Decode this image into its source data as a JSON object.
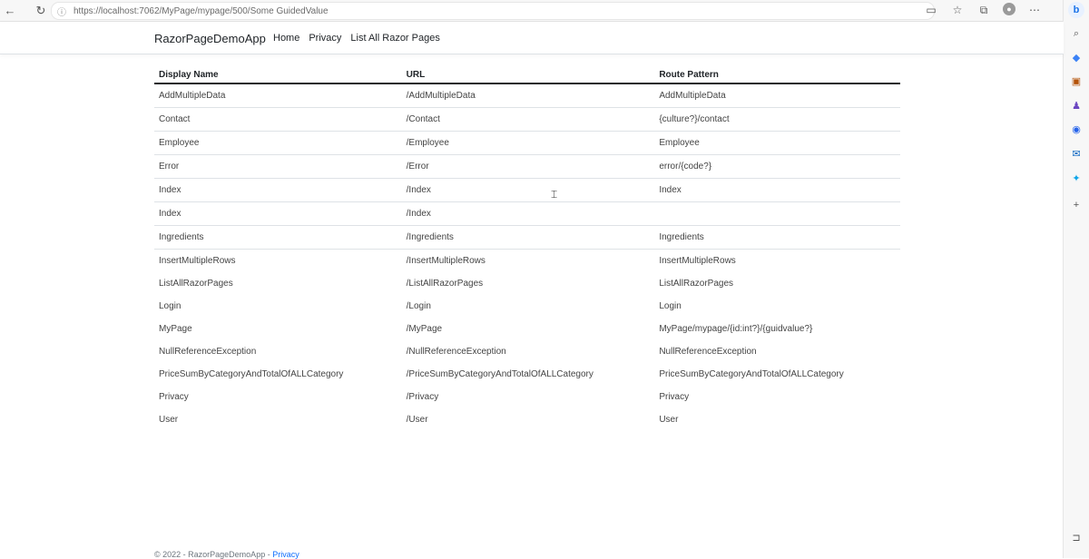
{
  "browser": {
    "url": "https://localhost:7062/MyPage/mypage/500/Some GuidedValue",
    "icons": [
      "back-icon",
      "refresh-icon",
      "info-icon",
      "split-screen-icon",
      "favorite-icon",
      "collections-icon",
      "profile-avatar",
      "more-icon"
    ]
  },
  "app": {
    "brand": "RazorPageDemoApp",
    "nav": [
      "Home",
      "Privacy",
      "List All Razor Pages"
    ]
  },
  "table": {
    "headers": [
      "Display Name",
      "URL",
      "Route Pattern"
    ],
    "rows": [
      [
        "AddMultipleData",
        "/AddMultipleData",
        "AddMultipleData"
      ],
      [
        "Contact",
        "/Contact",
        "{culture?}/contact"
      ],
      [
        "Employee",
        "/Employee",
        "Employee"
      ],
      [
        "Error",
        "/Error",
        "error/{code?}"
      ],
      [
        "Index",
        "/Index",
        "Index"
      ],
      [
        "Index",
        "/Index",
        ""
      ],
      [
        "Ingredients",
        "/Ingredients",
        "Ingredients"
      ],
      [
        "InsertMultipleRows",
        "/InsertMultipleRows",
        "InsertMultipleRows"
      ],
      [
        "ListAllRazorPages",
        "/ListAllRazorPages",
        "ListAllRazorPages"
      ],
      [
        "Login",
        "/Login",
        "Login"
      ],
      [
        "MyPage",
        "/MyPage",
        "MyPage/mypage/{id:int?}/{guidvalue?}"
      ],
      [
        "NullReferenceException",
        "/NullReferenceException",
        "NullReferenceException"
      ],
      [
        "PriceSumByCategoryAndTotalOfALLCategory",
        "/PriceSumByCategoryAndTotalOfALLCategory",
        "PriceSumByCategoryAndTotalOfALLCategory"
      ],
      [
        "Privacy",
        "/Privacy",
        "Privacy"
      ],
      [
        "User",
        "/User",
        "User"
      ]
    ],
    "borderless_from_row": 7
  },
  "footer": {
    "text": "© 2022 - RazorPageDemoApp - ",
    "link": "Privacy"
  }
}
